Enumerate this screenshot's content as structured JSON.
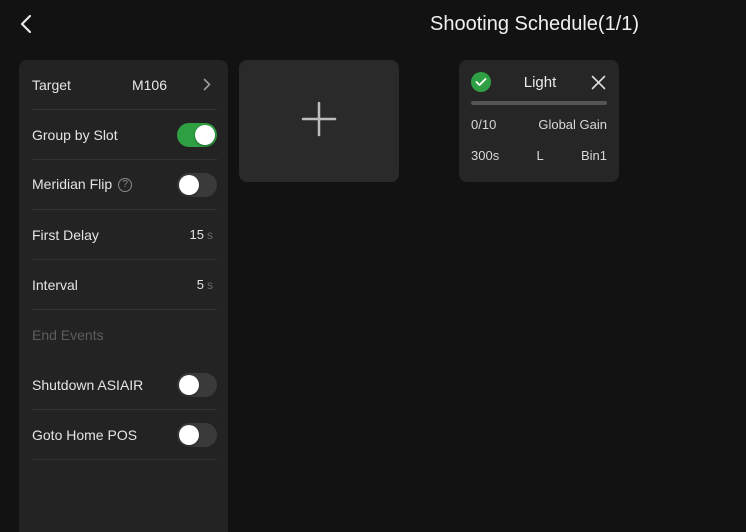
{
  "header": {
    "title": "Shooting Schedule(1/1)",
    "back_icon": "chevron-left-icon"
  },
  "settings": {
    "target_label": "Target",
    "target_value": "M106",
    "group_by_slot_label": "Group by Slot",
    "group_by_slot_on": true,
    "meridian_flip_label": "Meridian Flip",
    "meridian_flip_help": "?",
    "meridian_flip_on": false,
    "first_delay_label": "First Delay",
    "first_delay_value": "15",
    "first_delay_unit": "s",
    "interval_label": "Interval",
    "interval_value": "5",
    "interval_unit": "s",
    "end_events_label": "End Events",
    "shutdown_label": "Shutdown ASIAIR",
    "shutdown_on": false,
    "goto_home_label": "Goto Home POS",
    "goto_home_on": false
  },
  "add_card": {
    "icon": "plus-icon"
  },
  "light_card": {
    "title": "Light",
    "progress_text": "0/10",
    "progress_fraction": 0,
    "gain": "Global Gain",
    "exposure": "300s",
    "filter": "L",
    "binning": "Bin1"
  },
  "colors": {
    "background": "#121212",
    "panel": "#232323",
    "accent_green": "#2ea043"
  }
}
